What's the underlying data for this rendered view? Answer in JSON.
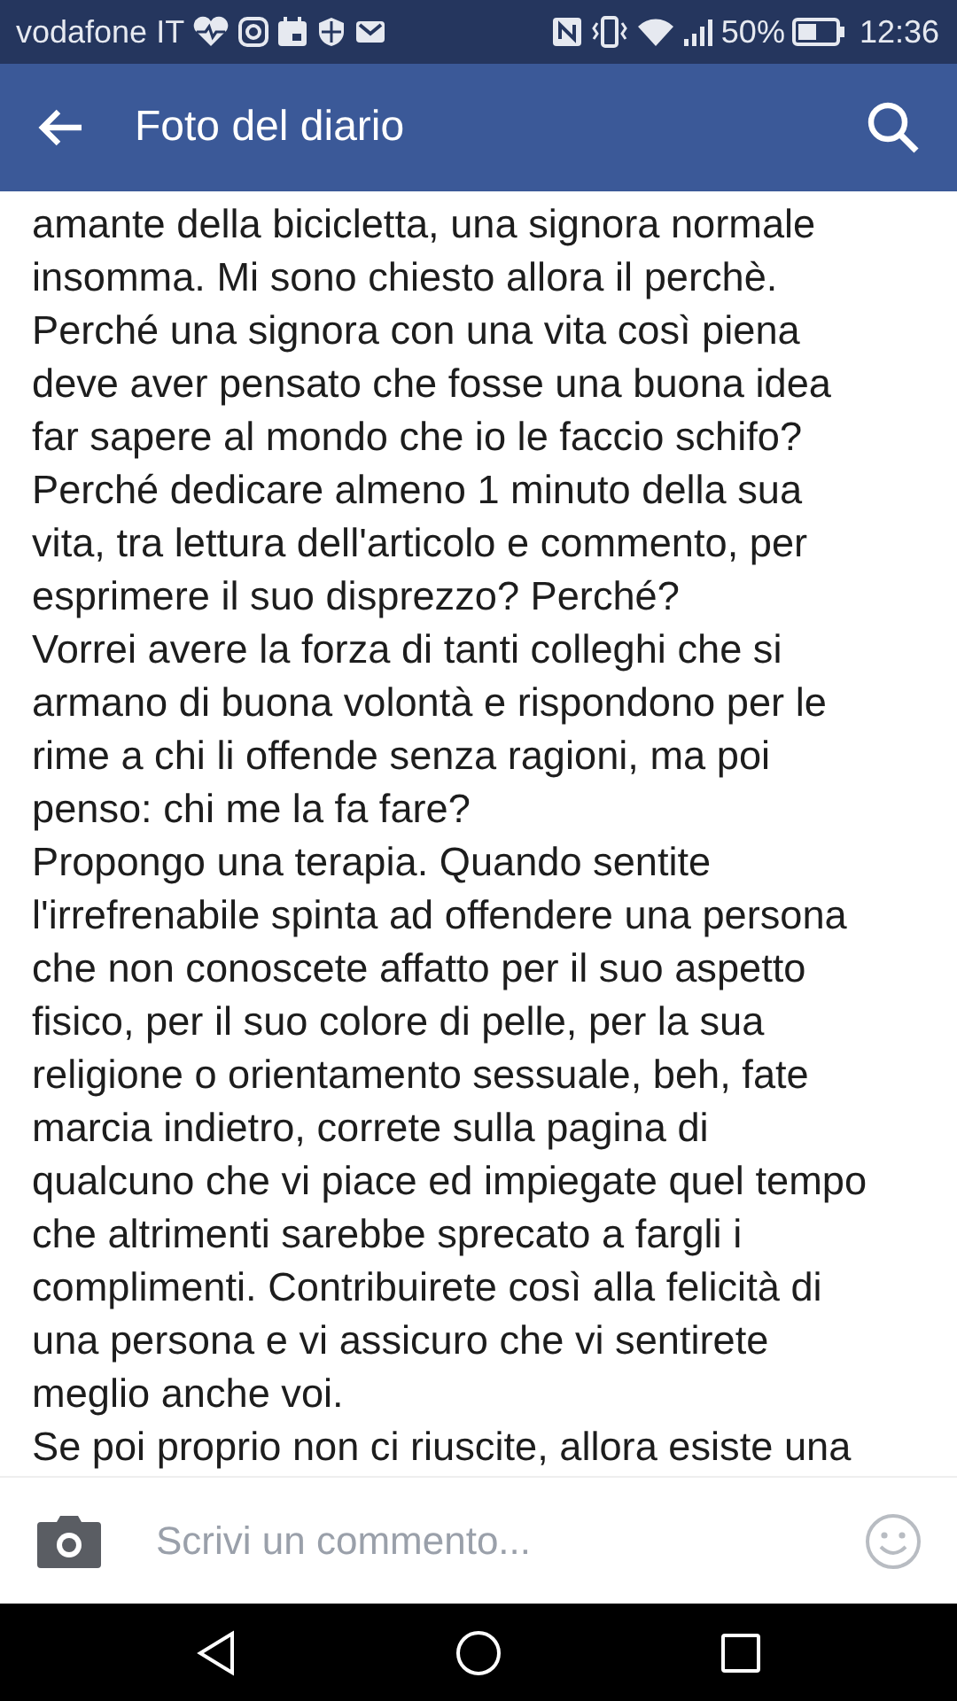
{
  "status_bar": {
    "carrier": "vodafone IT",
    "battery_percent": "50%",
    "time": "12:36"
  },
  "app_bar": {
    "title": "Foto del diario"
  },
  "paragraphs": [
    {
      "lines": [
        "amante della bicicletta, una signora normale",
        "insomma. Mi sono chiesto allora il perchè.",
        "Perché una signora con una vita così piena",
        "deve aver pensato che fosse una buona idea",
        "far sapere al mondo che io le faccio schifo?",
        "Perché dedicare almeno 1 minuto della sua",
        "vita, tra lettura dell'articolo e commento, per",
        "esprimere il suo disprezzo? Perché?"
      ]
    },
    {
      "lines": [
        "Vorrei avere la forza di tanti colleghi che si",
        "armano di buona volontà e rispondono per le",
        "rime a chi li offende senza ragioni, ma poi",
        "penso: chi me la fa fare?"
      ]
    },
    {
      "lines": [
        "Propongo una terapia. Quando sentite",
        "l'irrefrenabile spinta ad offendere una persona",
        "che non conoscete affatto per il suo aspetto",
        "fisico, per il suo colore di pelle, per la sua",
        "religione o orientamento sessuale, beh, fate",
        "marcia indietro, correte sulla pagina di",
        "qualcuno che vi piace ed impiegate quel tempo",
        "che altrimenti sarebbe sprecato a fargli i",
        "complimenti. Contribuirete così alla felicità di",
        "una persona e vi assicuro che vi sentirete",
        "meglio anche voi."
      ]
    },
    {
      "lines": [
        "Se poi proprio non ci riuscite, allora esiste una"
      ]
    }
  ],
  "comment_bar": {
    "placeholder": "Scrivi un commento..."
  }
}
